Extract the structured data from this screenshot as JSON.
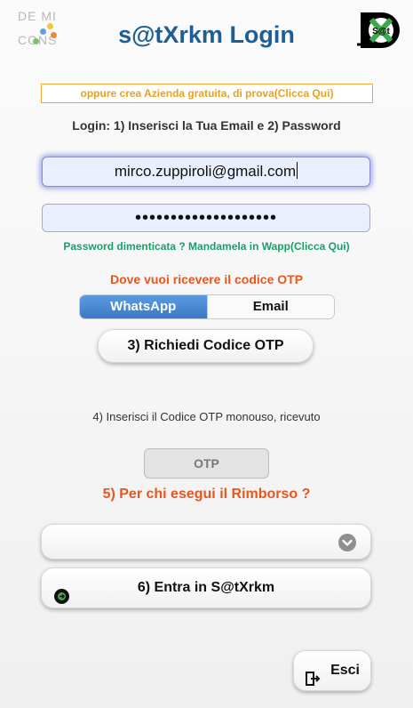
{
  "header": {
    "logo_left_line1": "DE MI",
    "logo_left_line2": "CONS",
    "title": "s@tXrkm Login",
    "logo_right_text": "S@t"
  },
  "promo_link": "oppure crea Azienda gratuita, di prova(Clicca Qui)",
  "login_instructions": "Login: 1) Inserisci la Tua Email e 2) Password",
  "email": {
    "value": "mirco.zuppiroli@gmail.com"
  },
  "password": {
    "masked_value": "••••••••••••••••••••"
  },
  "forgot_password_link": "Password dimenticata ? Mandamela in Wapp(Clicca Qui)",
  "otp_channel": {
    "question": "Dove vuoi ricevere il codice OTP",
    "options": [
      "WhatsApp",
      "Email"
    ],
    "selected": "WhatsApp"
  },
  "request_otp_label": "3) Richiedi Codice OTP",
  "step4_text": "4) Inserisci il Codice OTP monouso, ricevuto",
  "otp_placeholder": "OTP",
  "step5_text": "5) Per chi esegui il Rimborso ?",
  "reimbursement_select": {
    "value": ""
  },
  "enter_label": "6) Entra in S@tXrkm",
  "exit_label": "Esci",
  "colors": {
    "title": "#1d5f95",
    "orange_text": "#e8561f",
    "green_link": "#18a06a",
    "promo_border": "#f2a830",
    "segment_active": "#3a78c4"
  },
  "icons": [
    "search-icon",
    "chevron-down-icon",
    "login-icon",
    "exit-door-icon"
  ]
}
